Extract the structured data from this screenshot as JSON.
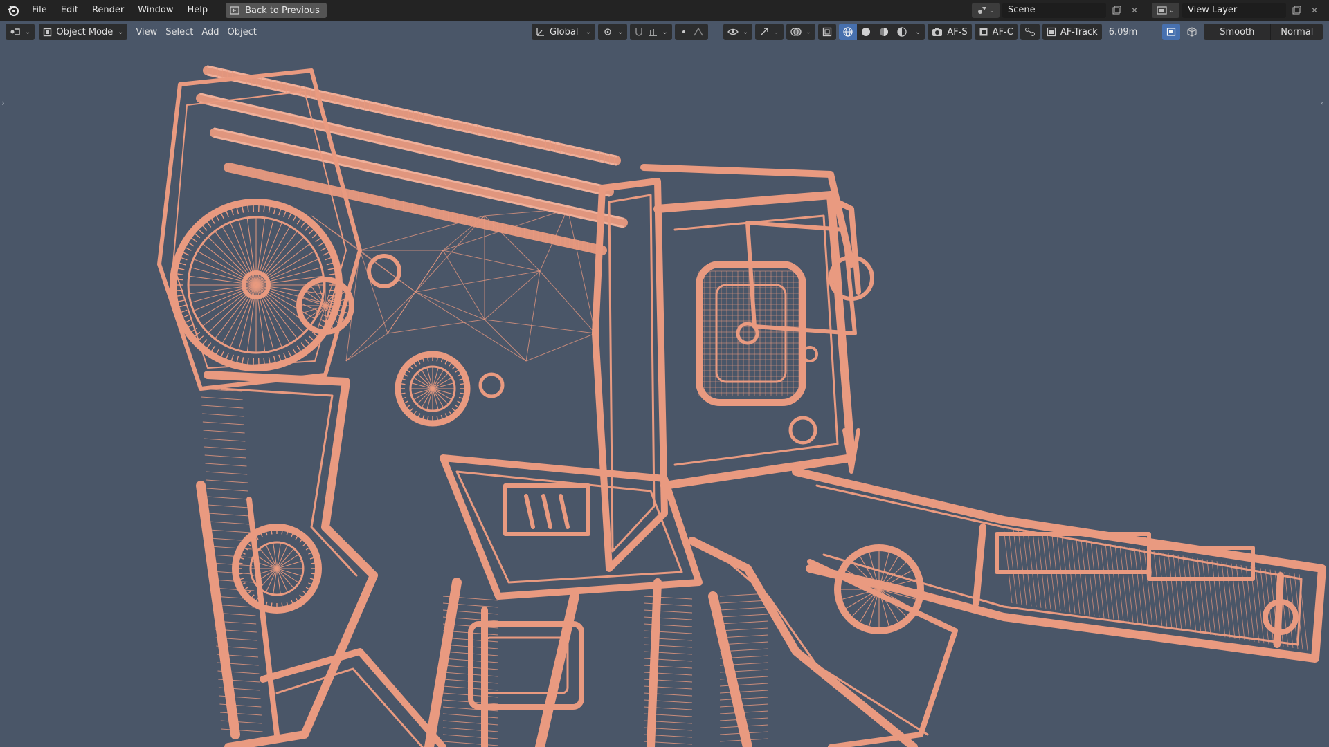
{
  "topbar": {
    "menus": [
      "File",
      "Edit",
      "Render",
      "Window",
      "Help"
    ],
    "back_label": "Back to Previous",
    "scene_label": "Scene",
    "view_layer_label": "View Layer"
  },
  "viewport_header": {
    "mode_label": "Object Mode",
    "menus": [
      "View",
      "Select",
      "Add",
      "Object"
    ],
    "transform_orientation": "Global",
    "af_s": "AF-S",
    "af_c": "AF-C",
    "af_track": "AF-Track",
    "distance": "6.09m",
    "smooth": "Smooth",
    "normal": "Normal"
  },
  "colors": {
    "viewport_bg": "#4a5668",
    "wire": "#e99a80",
    "topbar": "#232323",
    "accent": "#4772b3"
  },
  "icons": [
    "blender-logo-icon",
    "editor-type-icon",
    "object-mode-icon",
    "transform-orientation-icon",
    "snap-icon",
    "proportional-icon",
    "overlay-icon",
    "gizmo-icon",
    "xray-icon",
    "wireframe-shading-icon",
    "solid-shading-icon",
    "material-shading-icon",
    "rendered-shading-icon",
    "camera-icon",
    "scene-icon",
    "view-layer-icon"
  ]
}
